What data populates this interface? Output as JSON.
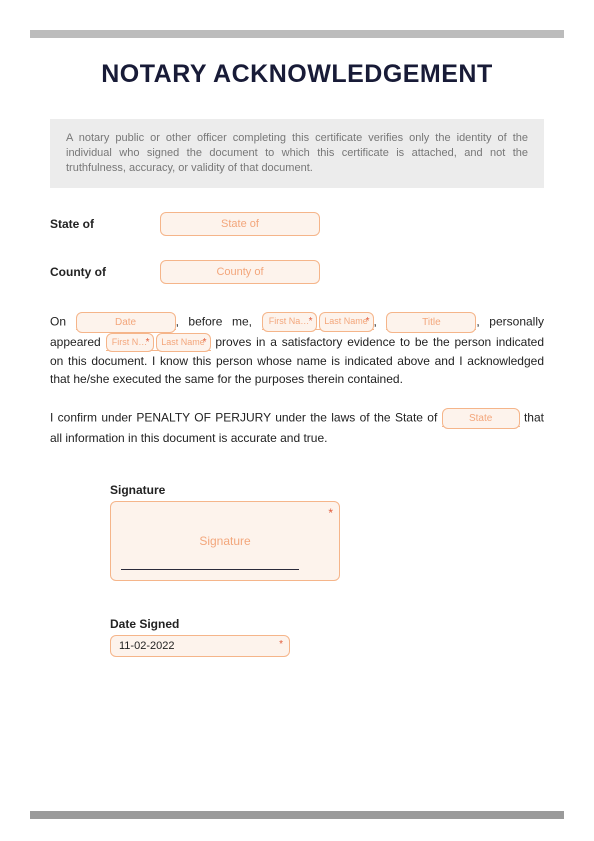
{
  "title": "NOTARY ACKNOWLEDGEMENT",
  "notice": "A notary public or other officer completing this certificate verifies only the identity of the individual who signed the document to which this certificate is attached, and not the truthfulness, accuracy, or validity of that document.",
  "labels": {
    "state_of": "State of",
    "county_of": "County of",
    "signature": "Signature",
    "date_signed": "Date Signed"
  },
  "placeholders": {
    "state_of": "State of",
    "county_of": "County of",
    "date": "Date",
    "first_name": "First Na…",
    "last_name": "Last Name",
    "title": "Title",
    "first_n": "First N…",
    "last_name2": "Last Name",
    "state": "State",
    "signature": "Signature"
  },
  "body": {
    "p1_a": "On ",
    "p1_b": ", before me, ",
    "p1_c": ", ",
    "p1_d": ", personally appeared ",
    "p1_e": " proves in a satisfactory evidence to be the person indicated on this document. I know this person whose name is indicated above and I acknowledged that he/she executed the same for the purposes therein contained.",
    "p2_a": "I confirm under PENALTY OF PERJURY under the laws of the State of ",
    "p2_b": " that all information in this document is accurate and true."
  },
  "values": {
    "date_signed": "11-02-2022"
  },
  "required_marker": "*"
}
